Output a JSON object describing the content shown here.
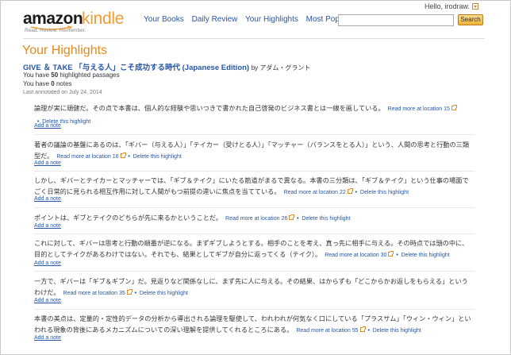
{
  "logo": {
    "amazon": "amazon",
    "kindle": "kindle",
    "tagline": "Read. Review. Remember."
  },
  "nav": [
    {
      "label": "Your Books"
    },
    {
      "label": "Daily Review"
    },
    {
      "label": "Your Highlights"
    },
    {
      "label": "Most Popular"
    }
  ],
  "user": {
    "greeting": "Hello, irodraw."
  },
  "search": {
    "value": "",
    "button_label": "Search"
  },
  "page_title": "Your Highlights",
  "book": {
    "title": "GIVE ＆ TAKE 「与える人」こそ成功する時代 (Japanese Edition)",
    "author": "by アダム・グラント",
    "highlights_prefix": "You have ",
    "highlights_count": "50",
    "highlights_suffix": " highlighted passages",
    "notes_prefix": "You have ",
    "notes_count": "0",
    "notes_suffix": " notes",
    "last_annotated": "Last annotated on July 24, 2014"
  },
  "labels": {
    "delete": "Delete this highlight",
    "add_note": "Add a note",
    "bullet": "•"
  },
  "highlights": [
    {
      "text": "論理が実に頑健だ。その点で本書は、個人的な経験や思いつきで書かれた自己啓発のビジネス書とは一線を画している。",
      "location": "Read more at location 15"
    },
    {
      "text": "著者の議論の基盤にあるのは、「ギバー（与える人）」「テイカー（受けとる人）」「マッチャー（バランスをとる人）」という、人間の思考と行動の三類型だ。",
      "location": "Read more at location 16"
    },
    {
      "text": "しかし、ギバーとテイカーとマッチャーでは、「ギブ＆テイク」にいたる筋道がまるで異なる。本書の三分類は、「ギブ＆テイク」という仕事の場面でごく日常的に見られる相互作用に対して人間がもつ前提の違いに焦点を当てている。",
      "location": "Read more at location 22"
    },
    {
      "text": "ポイントは、ギブとテイクのどちらが先に来るかということだ。",
      "location": "Read more at location 26"
    },
    {
      "text": "これに対して、ギバーは思考と行動の順番が逆になる。まずギブしようとする。相手のことを考え、真っ先に相手に与える。その時点では頭の中に、目的としてテイクがあるわけではない。それでも、結果としてギブが自分に返ってくる（テイク）。",
      "location": "Read more at location 30"
    },
    {
      "text": "一方で、ギバーは「ギブ＆ギブン」だ。見返りなど関係なしに、まず先に人に与える。その結果、はからずも「どこからかお返しをもらえる」というわけだ。",
      "location": "Read more at location 35"
    },
    {
      "text": "本書の美点は、定量的・定性的データの分析から導出される論理を駆使して、われわれが何気なく口にしている「プラスサム」「ウィン・ウィン」といわれる現象の背後にあるメカニズムについての深い理解を提供してくれるところにある。",
      "location": "Read more at location 55"
    }
  ]
}
